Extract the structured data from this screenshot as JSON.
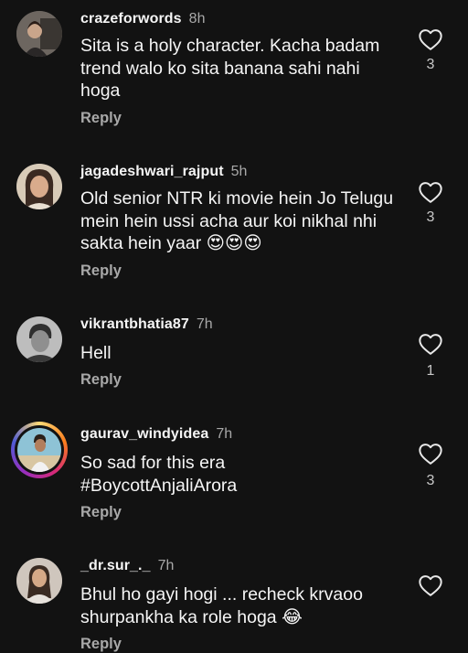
{
  "comments": [
    {
      "username": "crazeforwords",
      "time": "8h",
      "text": "Sita is a holy character. Kacha badam trend walo ko sita banana sahi nahi hoga",
      "reply_label": "Reply",
      "likes": "3",
      "avatar_icon": "profile-photo-icon"
    },
    {
      "username": "jagadeshwari_rajput",
      "time": "5h",
      "text": "Old senior NTR ki movie hein Jo Telugu mein hein ussi acha aur koi nikhal nhi sakta hein yaar",
      "emoji": "😍😍😍",
      "reply_label": "Reply",
      "likes": "3",
      "avatar_icon": "profile-photo-icon"
    },
    {
      "username": "vikrantbhatia87",
      "time": "7h",
      "text": "Hell",
      "reply_label": "Reply",
      "likes": "1",
      "avatar_icon": "profile-photo-icon"
    },
    {
      "username": "gaurav_windyidea",
      "time": "7h",
      "text": "So sad for this era #BoycottAnjaliArora",
      "reply_label": "Reply",
      "likes": "3",
      "avatar_icon": "story-ring-profile-photo-icon"
    },
    {
      "username": "_dr.sur_._",
      "time": "7h",
      "text": "Bhul ho gayi hogi ... recheck krvaoo shurpankha ka role hoga",
      "emoji": "😂",
      "reply_label": "Reply",
      "avatar_icon": "profile-photo-icon"
    }
  ],
  "colors": {
    "background": "#121212",
    "text": "#f5f5f5",
    "secondary": "#a8a8a8"
  }
}
